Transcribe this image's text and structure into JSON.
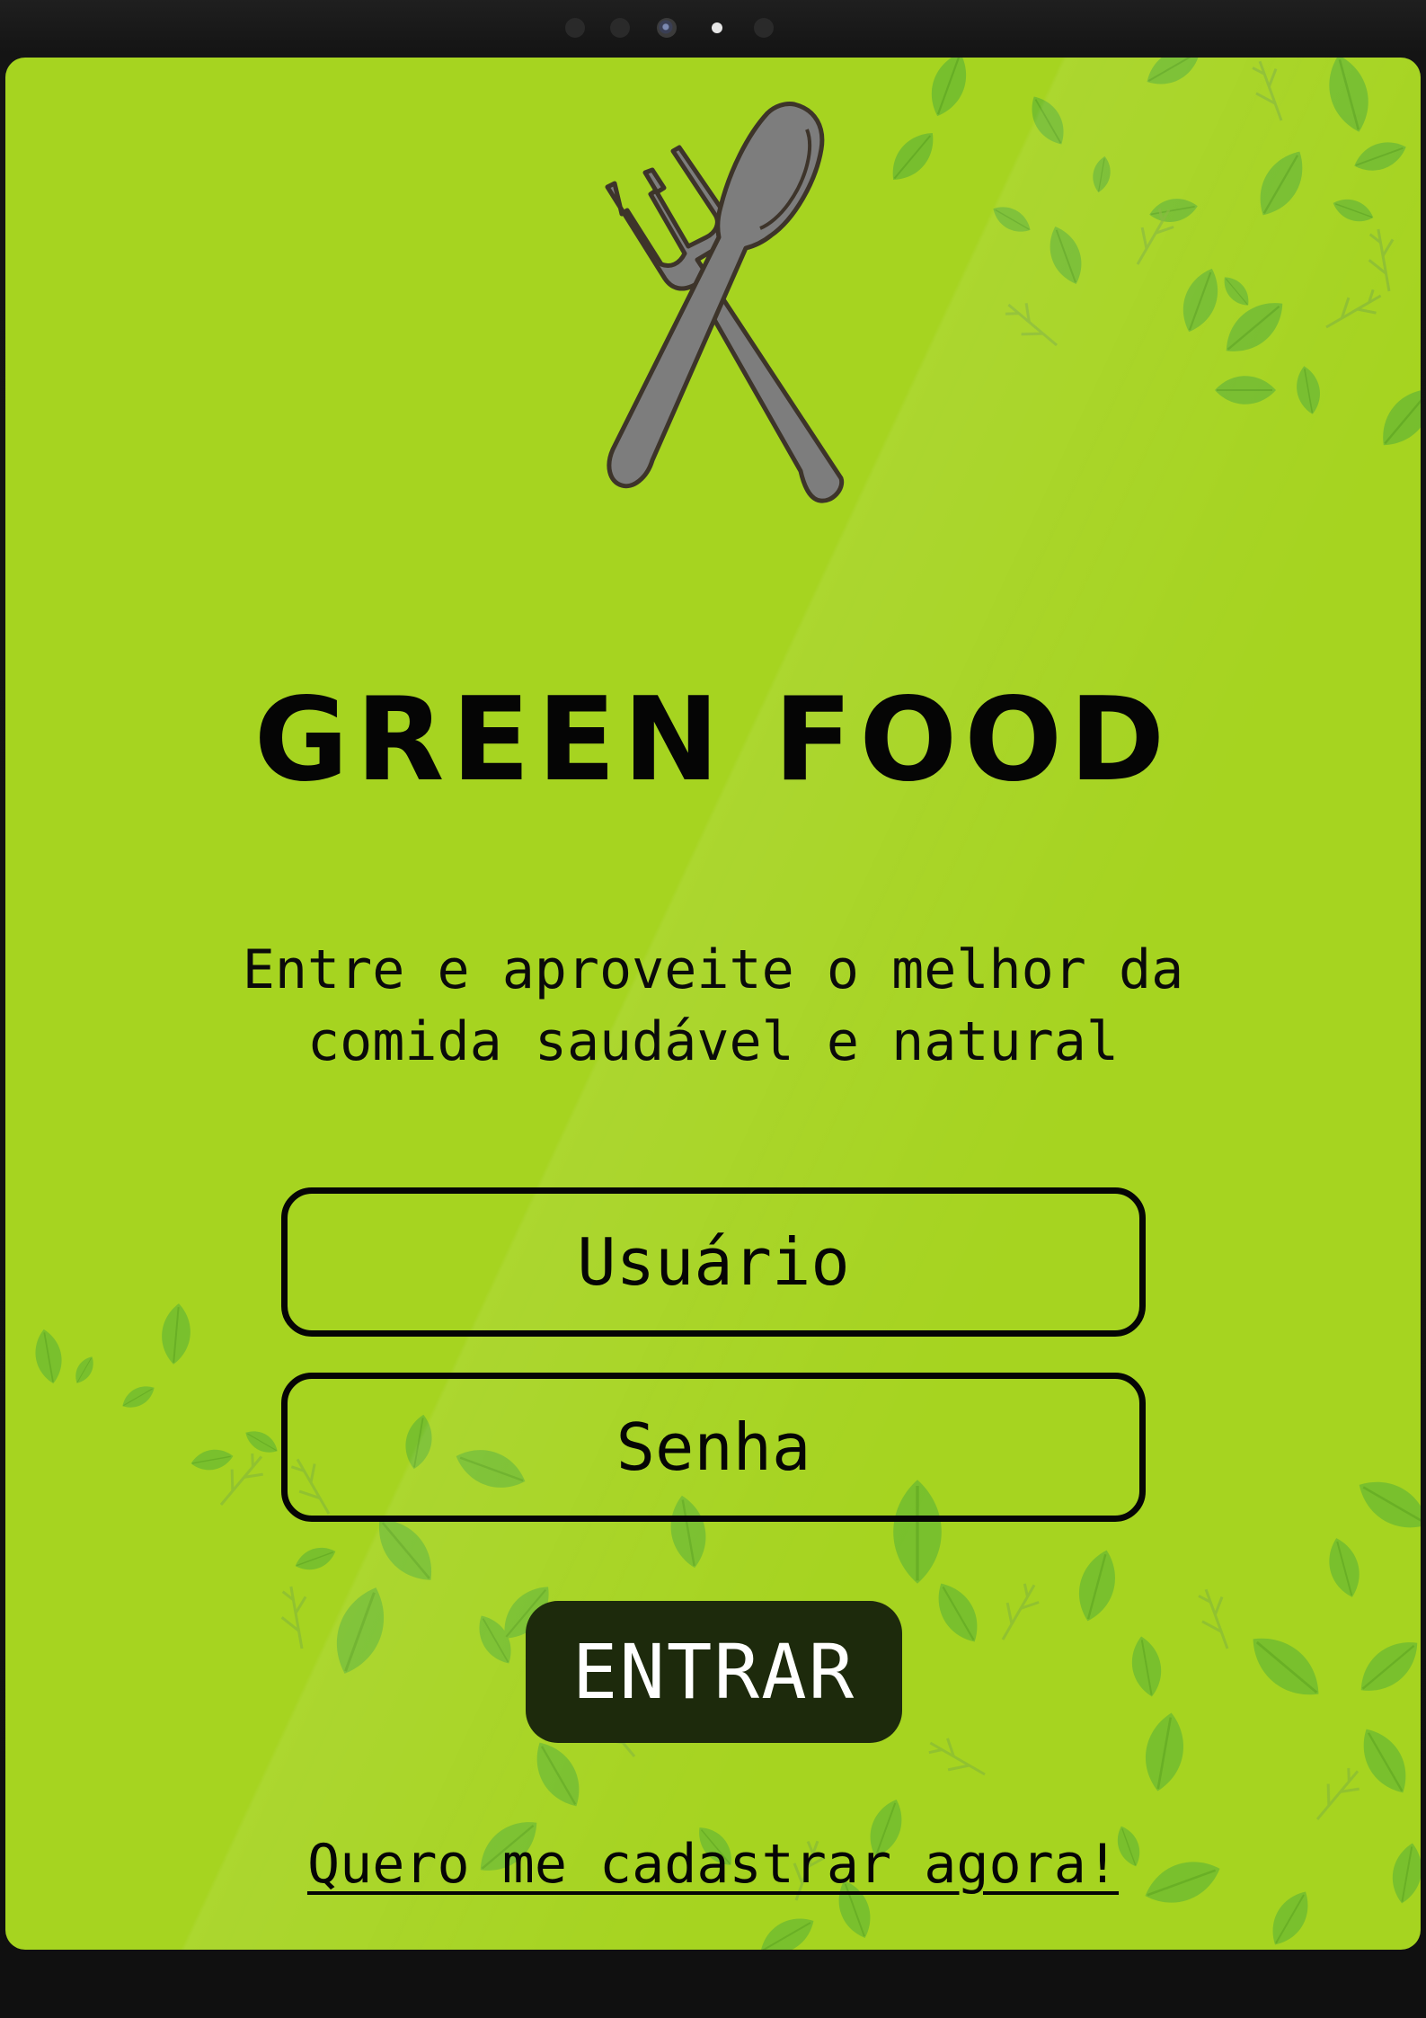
{
  "app": {
    "title": "GREEN FOOD",
    "tagline": "Entre e aproveite o melhor da\ncomida saudável e natural"
  },
  "logo": {
    "icon": "fork-and-spoon-icon"
  },
  "form": {
    "username_placeholder": "Usuário",
    "password_placeholder": "Senha",
    "submit_label": "ENTRAR"
  },
  "signup": {
    "link_text": "Quero me cadastrar agora!"
  },
  "colors": {
    "background": "#a6d420",
    "leaf": "#6ab82f",
    "button": "#1d2a0c",
    "text": "#050505",
    "utensil": "#7d7d7d"
  }
}
